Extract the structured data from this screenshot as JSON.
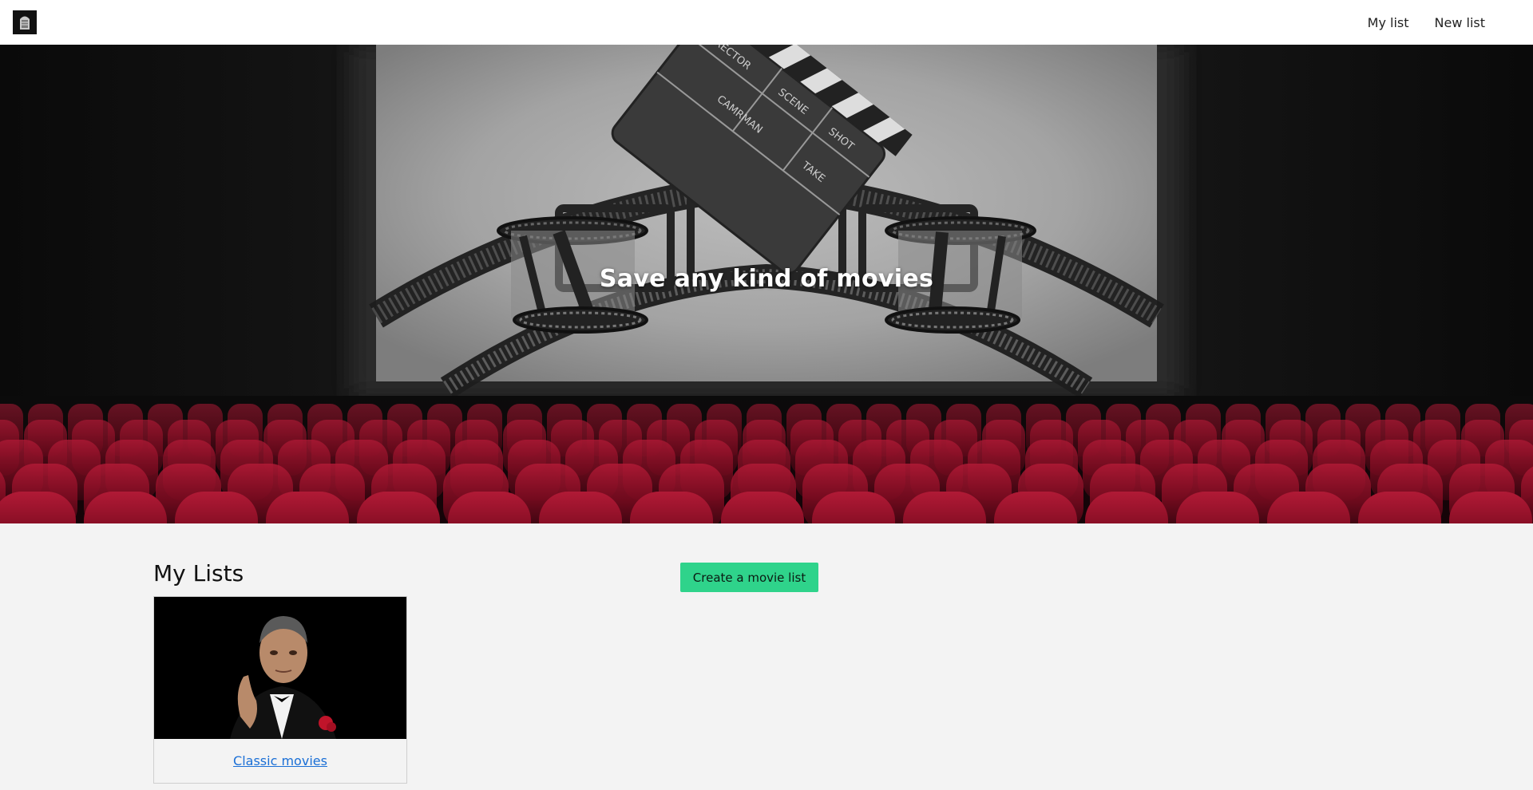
{
  "navbar": {
    "logo_icon": "cinema-logo-icon",
    "links": [
      "My list",
      "New list"
    ]
  },
  "hero": {
    "title": "Save any kind of movies",
    "clapper_labels": [
      "DIRECTOR",
      "SCENE",
      "SHOT",
      "TAKE",
      "CAMRMAN"
    ]
  },
  "main": {
    "lists_heading": "My Lists",
    "create_button": "Create a movie list",
    "lists": [
      {
        "title": "Classic movies",
        "image": "classic-movie-poster"
      }
    ]
  },
  "colors": {
    "accent": "#2fd38b",
    "link": "#1a6fd6",
    "seat": "#8b0f26",
    "screen": "#a6a6a6"
  }
}
